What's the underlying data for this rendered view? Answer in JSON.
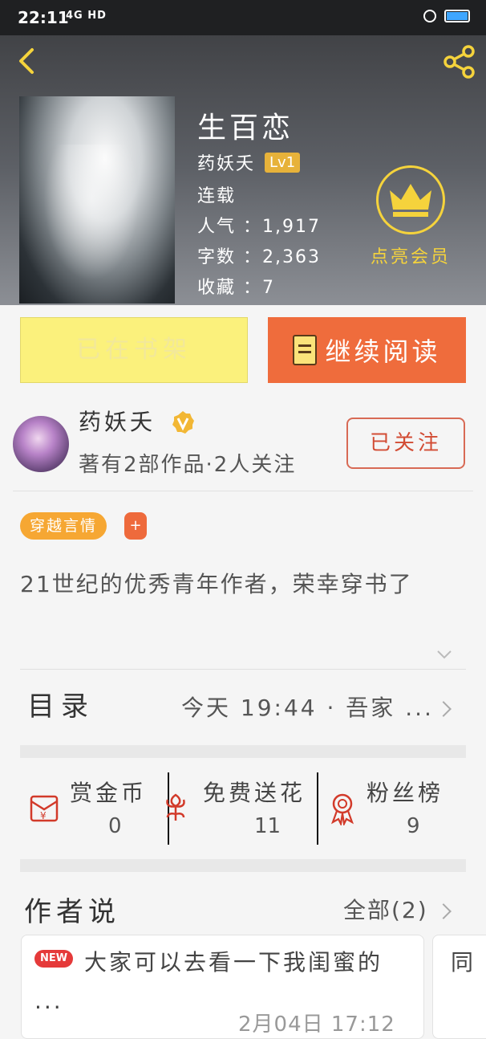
{
  "status": {
    "time": "22:11",
    "network": "4G HD"
  },
  "book": {
    "title": "生百恋",
    "author": "药妖夭",
    "level": "Lv1",
    "status": "连载",
    "popularity": "人气 ：1,917",
    "word_count": "字数 ：2,363",
    "favorites": "收藏 ：7"
  },
  "vip": {
    "label": "点亮会员"
  },
  "actions": {
    "shelf": "已在书架",
    "read": "继续阅读"
  },
  "author_info": {
    "name": "药妖夭",
    "summary": "著有2部作品·2人关注",
    "follow_label": "已关注"
  },
  "tags": {
    "genre": "穿越言情",
    "add": "+"
  },
  "description": "21世纪的优秀青年作者，荣幸穿书了",
  "catalog": {
    "title": "目录",
    "latest": "今天 19:44 · 吾家 ..."
  },
  "stats": [
    {
      "label": "赏金币",
      "value": "0"
    },
    {
      "label": "免费送花",
      "value": "11"
    },
    {
      "label": "粉丝榜",
      "value": "9"
    }
  ],
  "author_says": {
    "title": "作者说",
    "all": "全部(2)",
    "cards": [
      {
        "badge": "NEW",
        "text": "大家可以去看一下我闺蜜的 ...",
        "date": "2月04日 17:12"
      },
      {
        "text": "同"
      }
    ]
  },
  "colors": {
    "accent": "#ef6c3c",
    "gold": "#f5d33c",
    "shelf": "#fbf17c"
  }
}
